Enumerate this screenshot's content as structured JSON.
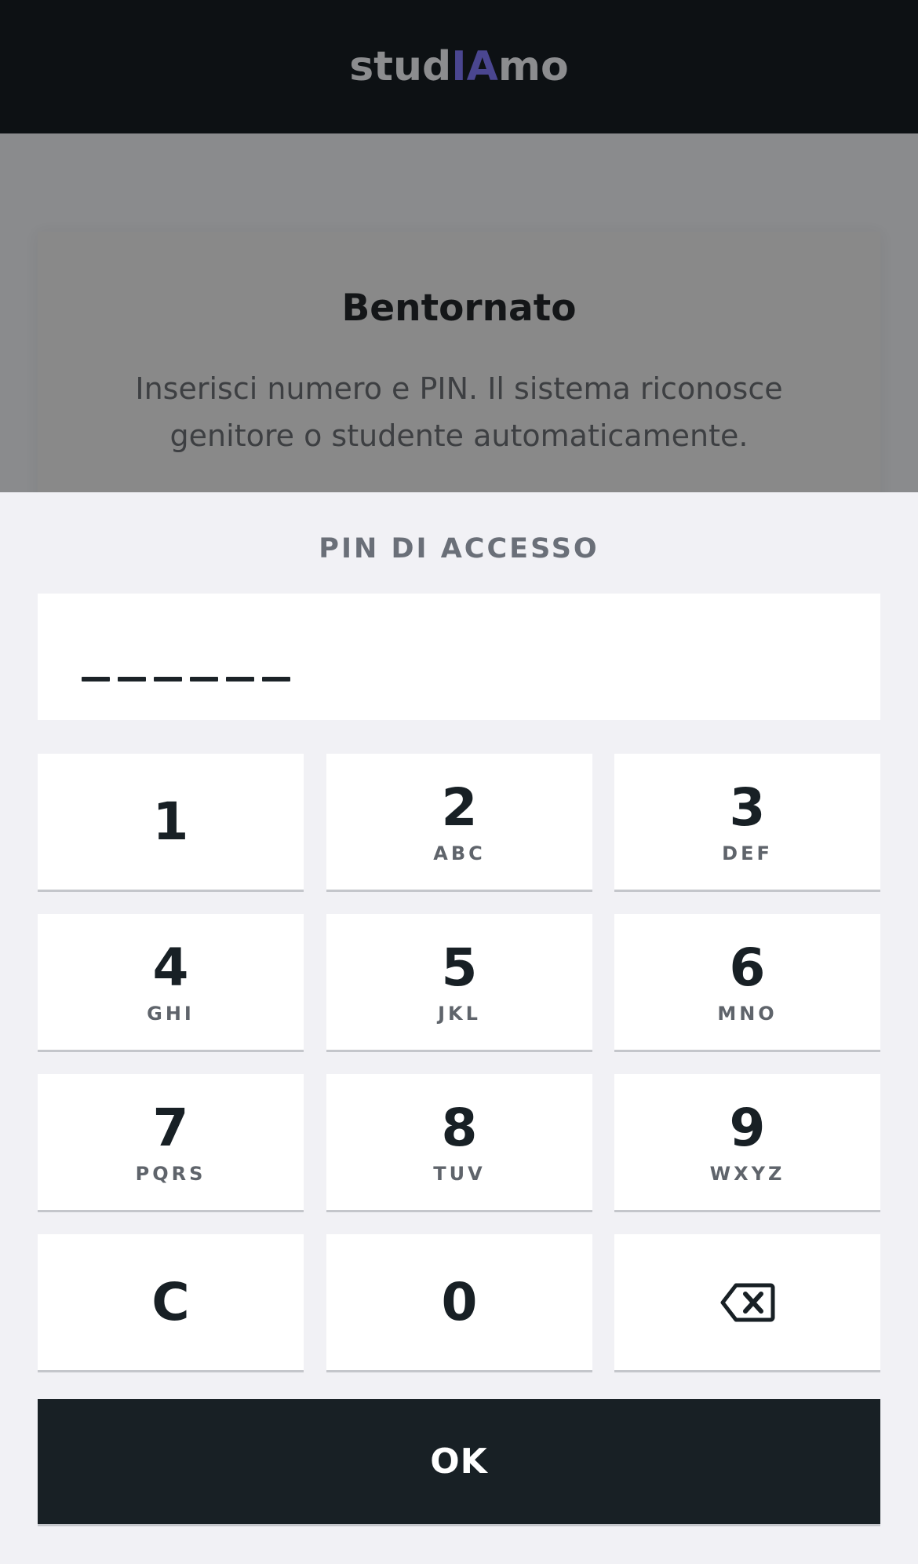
{
  "header": {
    "logo_prefix": "stud",
    "logo_highlight": "IA",
    "logo_suffix": "mo",
    "highlight_color": "#4a4690"
  },
  "card": {
    "title": "Bentornato",
    "text": "Inserisci numero e PIN. Il sistema riconosce genitore o studente automaticamente."
  },
  "sheet": {
    "pin_label": "PIN DI ACCESSO",
    "pin_length": 6,
    "keys": [
      {
        "digit": "1",
        "letters": ""
      },
      {
        "digit": "2",
        "letters": "ABC"
      },
      {
        "digit": "3",
        "letters": "DEF"
      },
      {
        "digit": "4",
        "letters": "GHI"
      },
      {
        "digit": "5",
        "letters": "JKL"
      },
      {
        "digit": "6",
        "letters": "MNO"
      },
      {
        "digit": "7",
        "letters": "PQRS"
      },
      {
        "digit": "8",
        "letters": "TUV"
      },
      {
        "digit": "9",
        "letters": "WXYZ"
      },
      {
        "digit": "C",
        "letters": ""
      },
      {
        "digit": "0",
        "letters": ""
      },
      {
        "icon": "backspace-icon"
      }
    ],
    "ok_label": "OK"
  },
  "colors": {
    "header_bg": "#0d1114",
    "backdrop": "#8a8b8d",
    "sheet_bg": "#f1f1f5",
    "key_bg": "#ffffff",
    "ok_bg": "#182025"
  }
}
